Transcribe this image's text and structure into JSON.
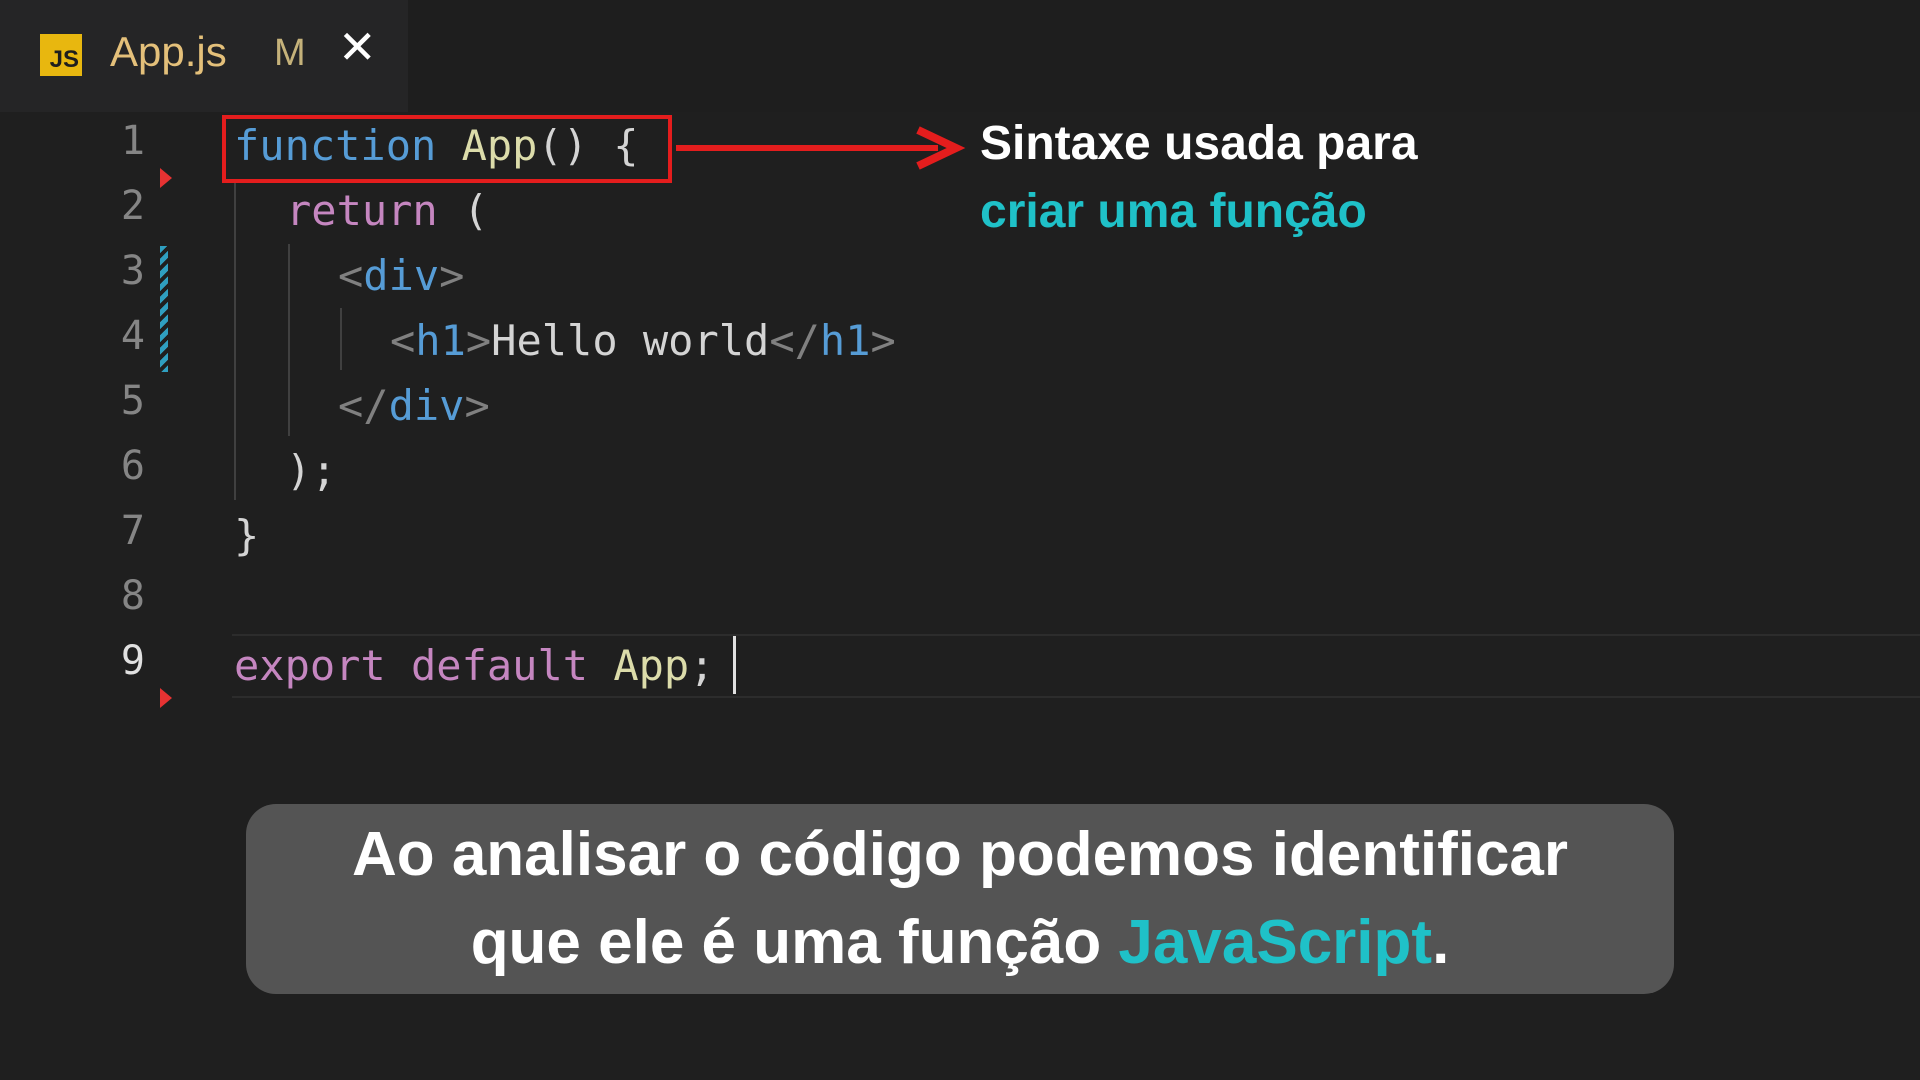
{
  "tab": {
    "icon": "js-file-icon",
    "icon_label": "JS",
    "filename": "App.js",
    "status": "M",
    "close_glyph": "✕"
  },
  "editor": {
    "line_numbers": [
      "1",
      "2",
      "3",
      "4",
      "5",
      "6",
      "7",
      "8",
      "9"
    ],
    "active_line": "9",
    "lines": {
      "l1": {
        "kw": "function",
        "name": "App",
        "rest": "() {"
      },
      "l2": {
        "kw": "return",
        "rest": " ("
      },
      "l3": {
        "open": "<",
        "tag": "div",
        "close": ">"
      },
      "l4": {
        "open": "<",
        "tag": "h1",
        "close": ">",
        "text": "Hello world",
        "open2": "</",
        "tag2": "h1",
        "close2": ">"
      },
      "l5": {
        "open": "</",
        "tag": "div",
        "close": ">"
      },
      "l6": {
        "text": ");"
      },
      "l7": {
        "text": "}"
      },
      "l9": {
        "kw1": "export",
        "kw2": "default",
        "name": "App",
        "rest": ";"
      }
    }
  },
  "annotation": {
    "line1": "Sintaxe usada para",
    "line2": "criar uma função"
  },
  "caption": {
    "line1": "Ao analisar o código podemos identificar",
    "line2_pre": "que ele é uma função ",
    "line2_accent": "JavaScript",
    "line2_post": "."
  },
  "colors": {
    "highlight_border": "#e41d1d",
    "accent_teal": "#1fc1c8",
    "caption_bg": "#545454"
  }
}
